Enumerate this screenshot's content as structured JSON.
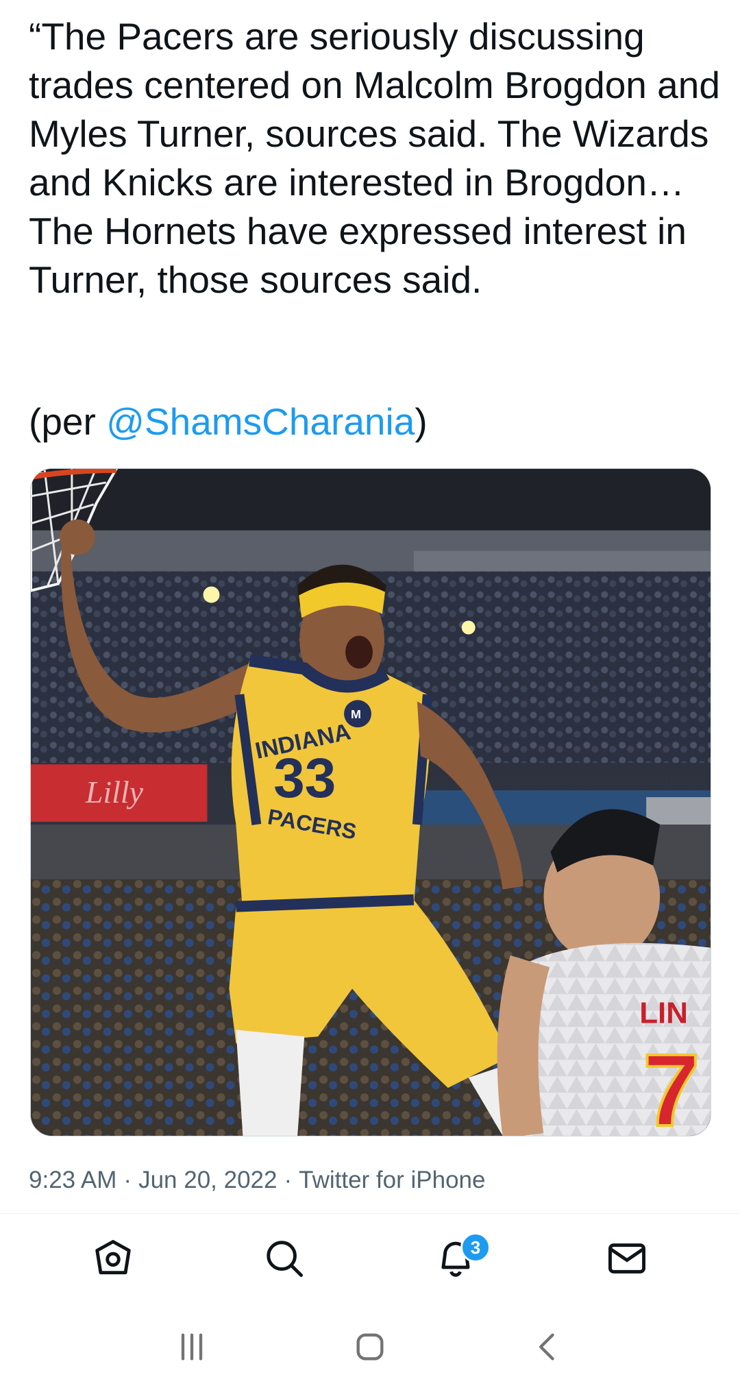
{
  "tweet": {
    "text": "“The Pacers are seriously discussing trades centered on Malcolm Brogdon and Myles Turner, sources said. The Wizards and Knicks are interested in Brogdon… The Hornets have expressed interest in Turner, those sources said.",
    "attribution_prefix": "(per ",
    "mention": "@ShamsCharania",
    "attribution_suffix": ")"
  },
  "media": {
    "jersey_top": "INDIANA",
    "jersey_number": "33",
    "jersey_bottom": "PACERS",
    "opponent_name": "LIN",
    "opponent_number": "7",
    "banner_text": "Lilly"
  },
  "meta": {
    "time": "9:23 AM",
    "date": "Jun 20, 2022",
    "source": "Twitter for iPhone",
    "separator": "·"
  },
  "bottom_nav": {
    "items": [
      {
        "icon": "home-icon"
      },
      {
        "icon": "search-icon"
      },
      {
        "icon": "notifications-icon",
        "badge": "3"
      },
      {
        "icon": "messages-icon"
      }
    ]
  },
  "system_nav": {
    "items": [
      {
        "icon": "recent-apps-icon"
      },
      {
        "icon": "home-circle-icon"
      },
      {
        "icon": "back-icon"
      }
    ]
  },
  "colors": {
    "accent": "#1d9bf0",
    "text": "#0f1419",
    "secondary": "#536471"
  }
}
